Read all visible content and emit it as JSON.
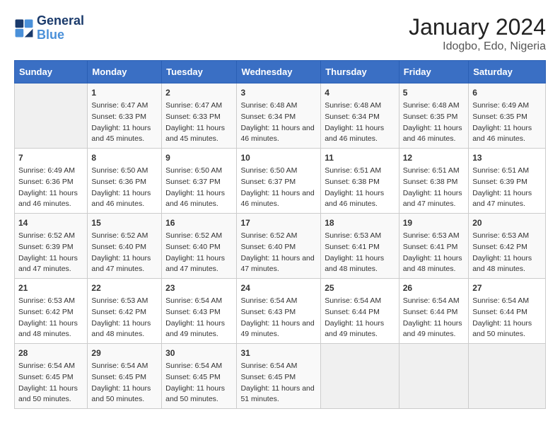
{
  "logo": {
    "line1": "General",
    "line2": "Blue"
  },
  "title": "January 2024",
  "subtitle": "Idogbo, Edo, Nigeria",
  "headers": [
    "Sunday",
    "Monday",
    "Tuesday",
    "Wednesday",
    "Thursday",
    "Friday",
    "Saturday"
  ],
  "weeks": [
    [
      {
        "day": "",
        "info": ""
      },
      {
        "day": "1",
        "info": "Sunrise: 6:47 AM\nSunset: 6:33 PM\nDaylight: 11 hours and 45 minutes."
      },
      {
        "day": "2",
        "info": "Sunrise: 6:47 AM\nSunset: 6:33 PM\nDaylight: 11 hours and 45 minutes."
      },
      {
        "day": "3",
        "info": "Sunrise: 6:48 AM\nSunset: 6:34 PM\nDaylight: 11 hours and 46 minutes."
      },
      {
        "day": "4",
        "info": "Sunrise: 6:48 AM\nSunset: 6:34 PM\nDaylight: 11 hours and 46 minutes."
      },
      {
        "day": "5",
        "info": "Sunrise: 6:48 AM\nSunset: 6:35 PM\nDaylight: 11 hours and 46 minutes."
      },
      {
        "day": "6",
        "info": "Sunrise: 6:49 AM\nSunset: 6:35 PM\nDaylight: 11 hours and 46 minutes."
      }
    ],
    [
      {
        "day": "7",
        "info": "Sunrise: 6:49 AM\nSunset: 6:36 PM\nDaylight: 11 hours and 46 minutes."
      },
      {
        "day": "8",
        "info": "Sunrise: 6:50 AM\nSunset: 6:36 PM\nDaylight: 11 hours and 46 minutes."
      },
      {
        "day": "9",
        "info": "Sunrise: 6:50 AM\nSunset: 6:37 PM\nDaylight: 11 hours and 46 minutes."
      },
      {
        "day": "10",
        "info": "Sunrise: 6:50 AM\nSunset: 6:37 PM\nDaylight: 11 hours and 46 minutes."
      },
      {
        "day": "11",
        "info": "Sunrise: 6:51 AM\nSunset: 6:38 PM\nDaylight: 11 hours and 46 minutes."
      },
      {
        "day": "12",
        "info": "Sunrise: 6:51 AM\nSunset: 6:38 PM\nDaylight: 11 hours and 47 minutes."
      },
      {
        "day": "13",
        "info": "Sunrise: 6:51 AM\nSunset: 6:39 PM\nDaylight: 11 hours and 47 minutes."
      }
    ],
    [
      {
        "day": "14",
        "info": "Sunrise: 6:52 AM\nSunset: 6:39 PM\nDaylight: 11 hours and 47 minutes."
      },
      {
        "day": "15",
        "info": "Sunrise: 6:52 AM\nSunset: 6:40 PM\nDaylight: 11 hours and 47 minutes."
      },
      {
        "day": "16",
        "info": "Sunrise: 6:52 AM\nSunset: 6:40 PM\nDaylight: 11 hours and 47 minutes."
      },
      {
        "day": "17",
        "info": "Sunrise: 6:52 AM\nSunset: 6:40 PM\nDaylight: 11 hours and 47 minutes."
      },
      {
        "day": "18",
        "info": "Sunrise: 6:53 AM\nSunset: 6:41 PM\nDaylight: 11 hours and 48 minutes."
      },
      {
        "day": "19",
        "info": "Sunrise: 6:53 AM\nSunset: 6:41 PM\nDaylight: 11 hours and 48 minutes."
      },
      {
        "day": "20",
        "info": "Sunrise: 6:53 AM\nSunset: 6:42 PM\nDaylight: 11 hours and 48 minutes."
      }
    ],
    [
      {
        "day": "21",
        "info": "Sunrise: 6:53 AM\nSunset: 6:42 PM\nDaylight: 11 hours and 48 minutes."
      },
      {
        "day": "22",
        "info": "Sunrise: 6:53 AM\nSunset: 6:42 PM\nDaylight: 11 hours and 48 minutes."
      },
      {
        "day": "23",
        "info": "Sunrise: 6:54 AM\nSunset: 6:43 PM\nDaylight: 11 hours and 49 minutes."
      },
      {
        "day": "24",
        "info": "Sunrise: 6:54 AM\nSunset: 6:43 PM\nDaylight: 11 hours and 49 minutes."
      },
      {
        "day": "25",
        "info": "Sunrise: 6:54 AM\nSunset: 6:44 PM\nDaylight: 11 hours and 49 minutes."
      },
      {
        "day": "26",
        "info": "Sunrise: 6:54 AM\nSunset: 6:44 PM\nDaylight: 11 hours and 49 minutes."
      },
      {
        "day": "27",
        "info": "Sunrise: 6:54 AM\nSunset: 6:44 PM\nDaylight: 11 hours and 50 minutes."
      }
    ],
    [
      {
        "day": "28",
        "info": "Sunrise: 6:54 AM\nSunset: 6:45 PM\nDaylight: 11 hours and 50 minutes."
      },
      {
        "day": "29",
        "info": "Sunrise: 6:54 AM\nSunset: 6:45 PM\nDaylight: 11 hours and 50 minutes."
      },
      {
        "day": "30",
        "info": "Sunrise: 6:54 AM\nSunset: 6:45 PM\nDaylight: 11 hours and 50 minutes."
      },
      {
        "day": "31",
        "info": "Sunrise: 6:54 AM\nSunset: 6:45 PM\nDaylight: 11 hours and 51 minutes."
      },
      {
        "day": "",
        "info": ""
      },
      {
        "day": "",
        "info": ""
      },
      {
        "day": "",
        "info": ""
      }
    ]
  ]
}
